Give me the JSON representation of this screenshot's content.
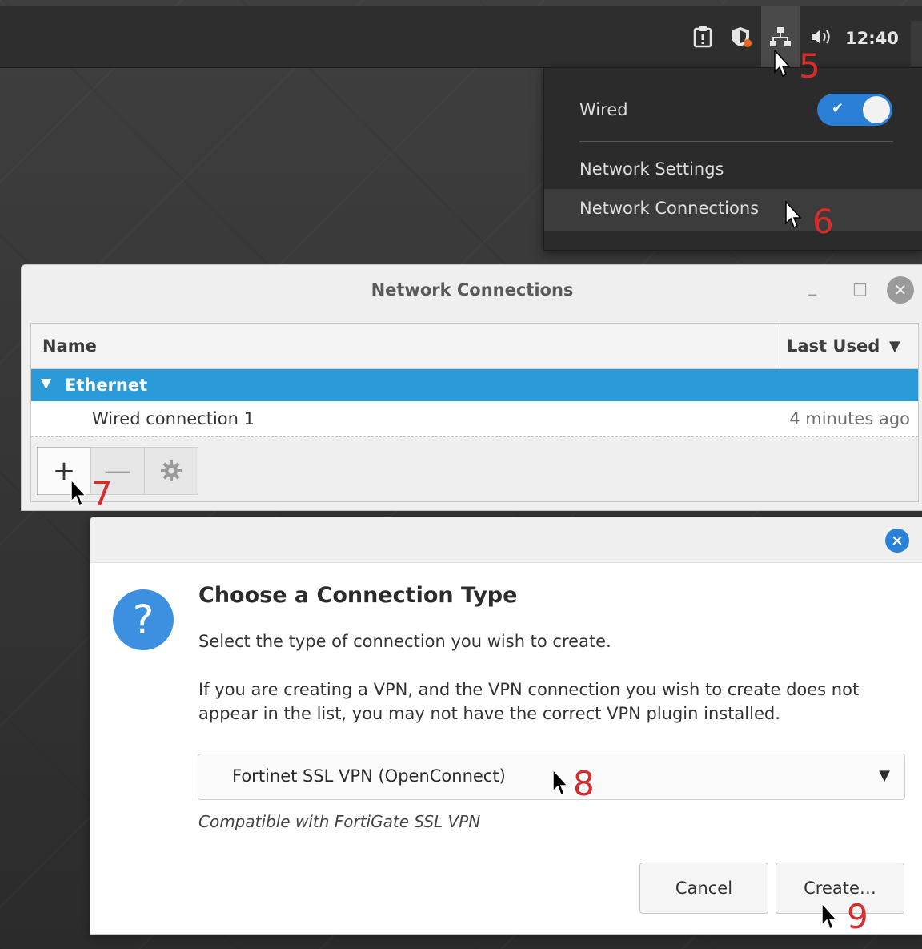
{
  "panel": {
    "clock": "12:40",
    "tray_icons": [
      "clipboard-icon",
      "shield-icon",
      "network-icon",
      "volume-icon"
    ]
  },
  "network_menu": {
    "wired_label": "Wired",
    "wired_enabled": true,
    "items": [
      "Network Settings",
      "Network Connections"
    ]
  },
  "connections_window": {
    "title": "Network Connections",
    "columns": {
      "name": "Name",
      "last_used": "Last Used"
    },
    "group": "Ethernet",
    "rows": [
      {
        "name": "Wired connection 1",
        "last_used": "4 minutes ago"
      }
    ],
    "toolbar": {
      "add": "+",
      "remove": "—"
    }
  },
  "dialog": {
    "title": "Choose a Connection Type",
    "subtitle": "Select the type of connection you wish to create.",
    "info_line1": "If you are creating a VPN, and the VPN connection you wish to create does not",
    "info_line2": "appear in the list, you may not have the correct VPN plugin installed.",
    "selected_type": "Fortinet SSL VPN (OpenConnect)",
    "description": "Compatible with FortiGate SSL VPN",
    "cancel_label": "Cancel",
    "create_label": "Create…",
    "close_label": "×",
    "help_glyph": "?"
  },
  "annotations": [
    "5",
    "6",
    "7",
    "8",
    "9"
  ],
  "colors": {
    "accent": "#2a9ad9",
    "annotation": "#d52c2c",
    "switch_on": "#2a7fd6"
  }
}
